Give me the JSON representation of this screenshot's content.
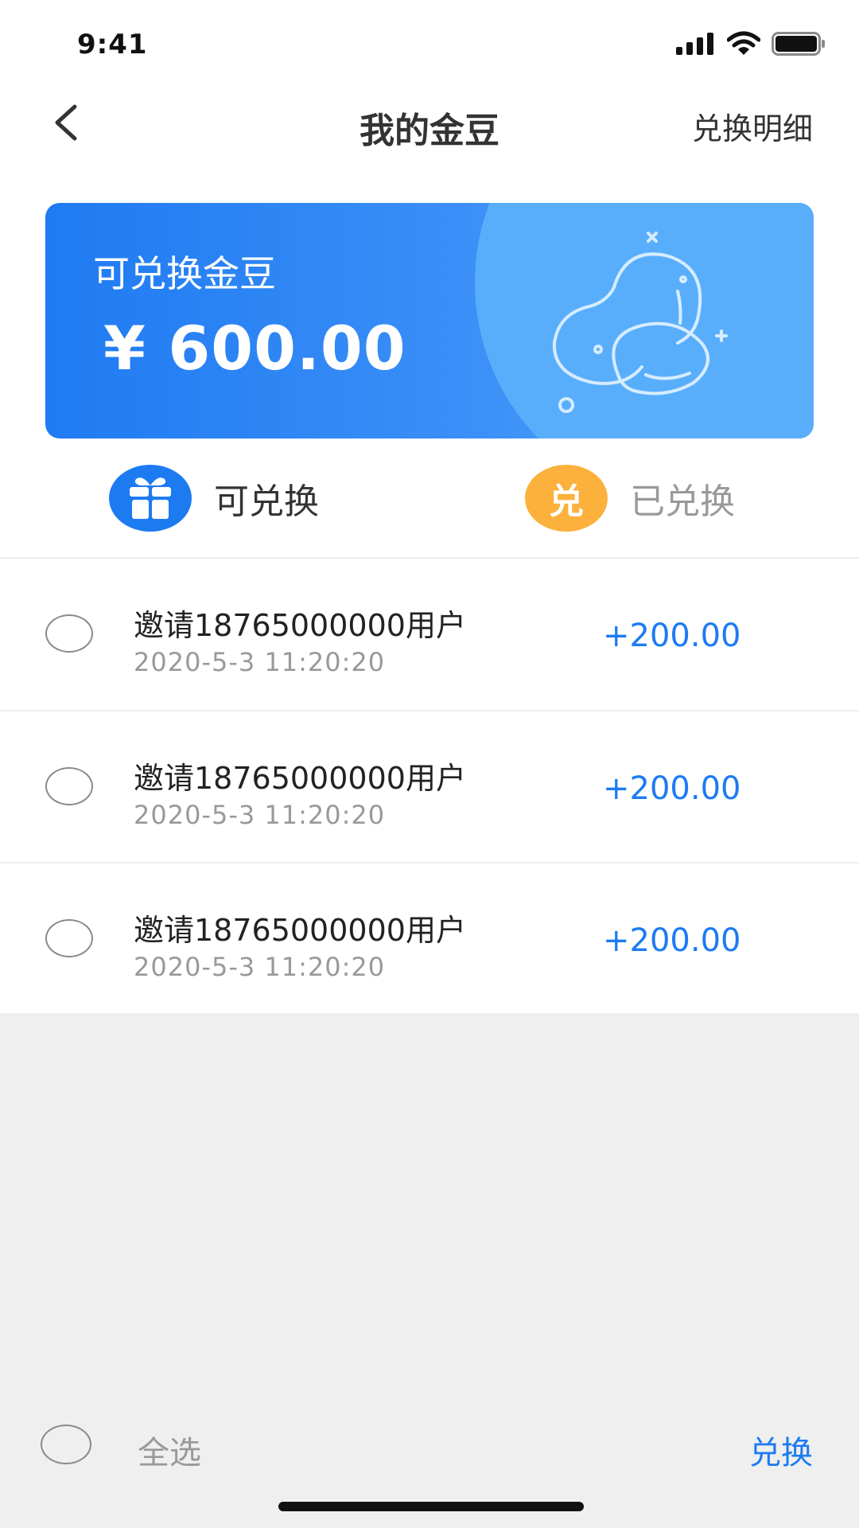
{
  "status_bar": {
    "time": "9:41"
  },
  "nav": {
    "title": "我的金豆",
    "right_link": "兑换明细"
  },
  "card": {
    "label": "可兑换金豆",
    "amount": "¥ 600.00"
  },
  "tabs": [
    {
      "label": "可兑换",
      "icon": "gift-icon",
      "color": "#1d7bf2"
    },
    {
      "label": "已兑换",
      "icon_text": "兑",
      "color": "#fbb13c"
    }
  ],
  "records": [
    {
      "title": "邀请18765000000用户",
      "time": "2020-5-3   11:20:20",
      "amount": "+200.00"
    },
    {
      "title": "邀请18765000000用户",
      "time": "2020-5-3   11:20:20",
      "amount": "+200.00"
    },
    {
      "title": "邀请18765000000用户",
      "time": "2020-5-3   11:20:20",
      "amount": "+200.00"
    }
  ],
  "footer": {
    "select_all": "全选",
    "exchange": "兑换"
  },
  "colors": {
    "accent": "#1d7bf2",
    "orange": "#fbb13c",
    "page_bg": "#efefef"
  }
}
